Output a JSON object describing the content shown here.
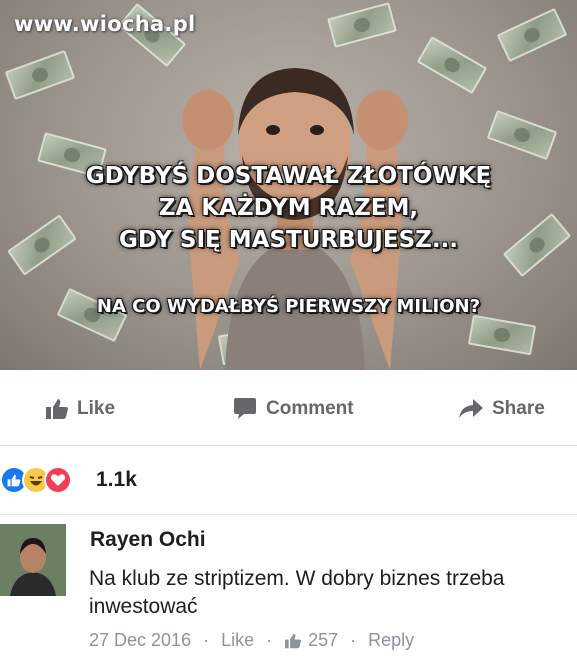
{
  "watermark": "www.wiocha.pl",
  "meme": {
    "caption_lines": [
      "GDYBYŚ DOSTAWAŁ ZŁOTÓWKĘ",
      "ZA KAŻDYM RAZEM,",
      "GDY SIĘ MASTURBUJESZ..."
    ],
    "question": "NA CO WYDAŁBYŚ PIERWSZY MILION?"
  },
  "actions": {
    "like_label": "Like",
    "comment_label": "Comment",
    "share_label": "Share"
  },
  "reactions": {
    "icons": [
      "like-reaction-icon",
      "haha-reaction-icon",
      "love-reaction-icon"
    ],
    "count": "1.1k"
  },
  "comment": {
    "author": "Rayen Ochi",
    "text": "Na klub ze striptizem. W dobry biznes trzeba inwestować",
    "date": "27 Dec 2016",
    "like_label": "Like",
    "likes_count": "257",
    "reply_label": "Reply"
  },
  "colors": {
    "facebook_blue": "#1877f2",
    "gray_text": "#65676b",
    "love_red": "#f33e58",
    "haha_yellow": "#f7c94b"
  }
}
